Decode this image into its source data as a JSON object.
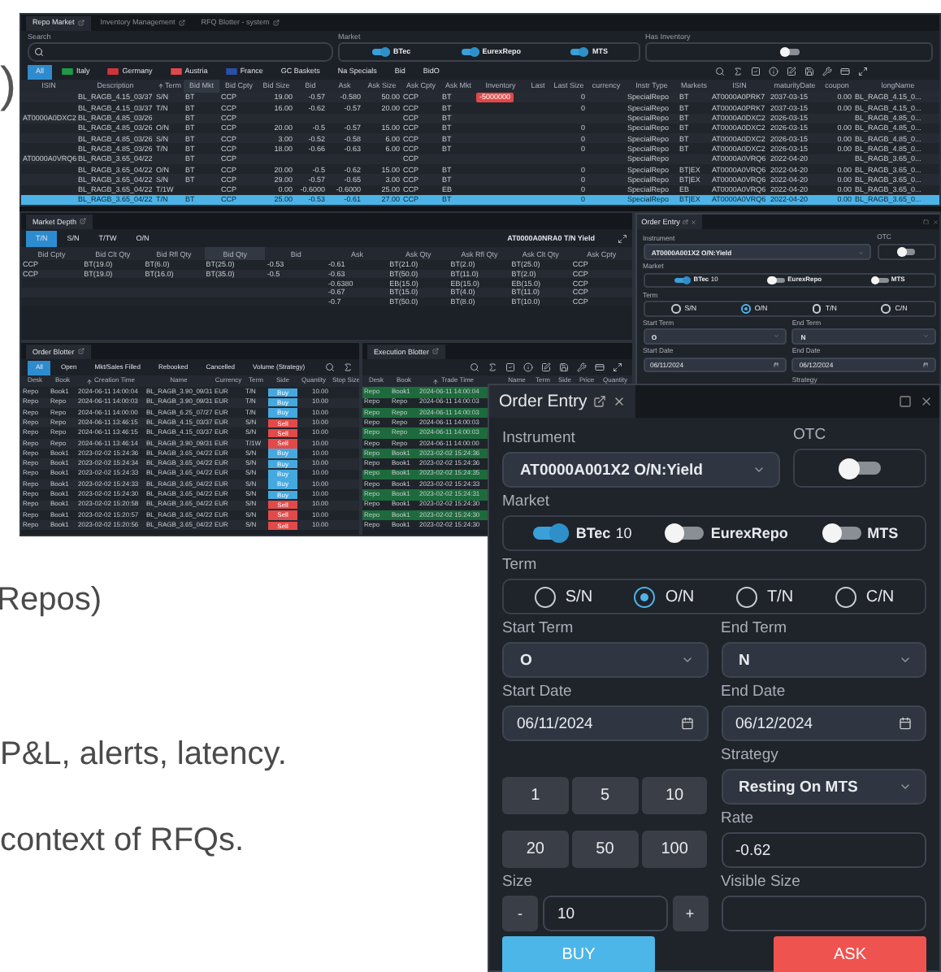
{
  "page_text": {
    "paren": ")",
    "line_1": "Repos)",
    "line_2": "P&L, alerts, latency.",
    "line_3": "context of RFQs."
  },
  "screenshot": {
    "tabs": [
      {
        "label": "Repo Market",
        "selected": true
      },
      {
        "label": "Inventory Management",
        "selected": false
      },
      {
        "label": "RFQ Blotter - system",
        "selected": false
      }
    ],
    "search_label": "Search",
    "market_label": "Market",
    "markets": [
      {
        "label": "BTec",
        "on": true
      },
      {
        "label": "EurexRepo",
        "on": true
      },
      {
        "label": "MTS",
        "on": true
      }
    ],
    "inventory_label": "Has Inventory",
    "inventory_on": false,
    "filters": [
      {
        "label": "All",
        "selected": true
      },
      {
        "label": "Italy",
        "selected": false,
        "color": "#1f9a48"
      },
      {
        "label": "Germany",
        "selected": false,
        "color": "#d0343b"
      },
      {
        "label": "Austria",
        "selected": false,
        "color": "#e0474c"
      },
      {
        "label": "France",
        "selected": false,
        "color": "#2a4fa8"
      },
      {
        "label": "GC Baskets",
        "selected": false
      },
      {
        "label": "Na Specials",
        "selected": false
      },
      {
        "label": "Bid",
        "selected": false
      },
      {
        "label": "BidO",
        "selected": false
      }
    ],
    "columns": [
      {
        "label": "ISIN",
        "sorted": false,
        "highlighted": false
      },
      {
        "label": "Description",
        "sorted": false,
        "highlighted": false
      },
      {
        "label": "Term",
        "sorted": true,
        "highlighted": false
      },
      {
        "label": "Bid Mkt",
        "sorted": false,
        "highlighted": true
      },
      {
        "label": "Bid Cpty",
        "sorted": false,
        "highlighted": false
      },
      {
        "label": "Bid Size",
        "sorted": false,
        "highlighted": false
      },
      {
        "label": "Bid",
        "sorted": false,
        "highlighted": false
      },
      {
        "label": "Ask",
        "sorted": false,
        "highlighted": false
      },
      {
        "label": "Ask Size",
        "sorted": false,
        "highlighted": false
      },
      {
        "label": "Ask Cpty",
        "sorted": false,
        "highlighted": false
      },
      {
        "label": "Ask Mkt",
        "sorted": false,
        "highlighted": false
      },
      {
        "label": "Inventory",
        "sorted": false,
        "highlighted": false
      },
      {
        "label": "Last",
        "sorted": false,
        "highlighted": false
      },
      {
        "label": "Last Size",
        "sorted": false,
        "highlighted": false
      },
      {
        "label": "currency",
        "sorted": false,
        "highlighted": false
      },
      {
        "label": "Instr Type",
        "sorted": false,
        "highlighted": false
      },
      {
        "label": "Markets",
        "sorted": false,
        "highlighted": false
      },
      {
        "label": "ISIN",
        "sorted": false,
        "highlighted": false
      },
      {
        "label": "maturityDate",
        "sorted": false,
        "highlighted": false
      },
      {
        "label": "coupon",
        "sorted": false,
        "highlighted": false
      },
      {
        "label": "longName",
        "sorted": false,
        "highlighted": false
      }
    ],
    "rows": [
      {
        "selected": false,
        "cells": [
          null,
          "BL_RAGB_4.15_03/37",
          "S/N",
          "BT",
          "CCP",
          "19.00",
          "-0.57",
          "-0.580",
          "50.00",
          "CCP",
          "BT",
          "-5000000",
          null,
          "0",
          null,
          "SpecialRepo",
          "BT",
          "AT0000A0PRK7",
          "2037-03-15",
          "0.00",
          "BL_RAGB_4.15_0..."
        ]
      },
      {
        "selected": false,
        "cells": [
          null,
          "BL_RAGB_4.15_03/37",
          "T/N",
          "BT",
          "CCP",
          "16.00",
          "-0.62",
          "-0.57",
          "20.00",
          "CCP",
          "BT",
          null,
          null,
          "0",
          null,
          "SpecialRepo",
          "BT",
          "AT0000A0PRK7",
          "2037-03-15",
          "0.00",
          "BL_RAGB_4.15_0..."
        ]
      },
      {
        "selected": false,
        "cells": [
          "AT0000A0DXC2",
          "BL_RAGB_4.85_03/26",
          null,
          "BT",
          "CCP",
          null,
          null,
          null,
          null,
          "CCP",
          "BT",
          null,
          null,
          null,
          null,
          "SpecialRepo",
          "BT",
          "AT0000A0DXC2",
          "2026-03-15",
          null,
          "BL_RAGB_4.85_0..."
        ]
      },
      {
        "selected": false,
        "cells": [
          null,
          "BL_RAGB_4.85_03/26",
          "O/N",
          "BT",
          "CCP",
          "20.00",
          "-0.5",
          "-0.57",
          "15.00",
          "CCP",
          "BT",
          null,
          null,
          "0",
          null,
          "SpecialRepo",
          "BT",
          "AT0000A0DXC2",
          "2026-03-15",
          "0.00",
          "BL_RAGB_4.85_0..."
        ]
      },
      {
        "selected": false,
        "cells": [
          null,
          "BL_RAGB_4.85_03/26",
          "S/N",
          "BT",
          "CCP",
          "3.00",
          "-0.52",
          "-0.58",
          "6.00",
          "CCP",
          "BT",
          null,
          null,
          "0",
          null,
          "SpecialRepo",
          "BT",
          "AT0000A0DXC2",
          "2026-03-15",
          "0.00",
          "BL_RAGB_4.85_0..."
        ]
      },
      {
        "selected": false,
        "cells": [
          null,
          "BL_RAGB_4.85_03/26",
          "T/N",
          "BT",
          "CCP",
          "18.00",
          "-0.66",
          "-0.63",
          "6.00",
          "CCP",
          "BT",
          null,
          null,
          "0",
          null,
          "SpecialRepo",
          "BT",
          "AT0000A0DXC2",
          "2026-03-15",
          "0.00",
          "BL_RAGB_4.85_0..."
        ]
      },
      {
        "selected": false,
        "cells": [
          "AT0000A0VRQ6",
          "BL_RAGB_3.65_04/22",
          null,
          "BT",
          "CCP",
          null,
          null,
          null,
          null,
          "CCP",
          null,
          null,
          null,
          null,
          null,
          "SpecialRepo",
          null,
          "AT0000A0VRQ6",
          "2022-04-20",
          null,
          "BL_RAGB_3.65_0..."
        ]
      },
      {
        "selected": false,
        "cells": [
          null,
          "BL_RAGB_3.65_04/22",
          "O/N",
          "BT",
          "CCP",
          "20.00",
          "-0.5",
          "-0.62",
          "15.00",
          "CCP",
          "BT",
          null,
          null,
          "0",
          null,
          "SpecialRepo",
          "BT|EX",
          "AT0000A0VRQ6",
          "2022-04-20",
          "0.00",
          "BL_RAGB_3.65_0..."
        ]
      },
      {
        "selected": false,
        "cells": [
          null,
          "BL_RAGB_3.65_04/22",
          "S/N",
          "BT",
          "CCP",
          "29.00",
          "-0.57",
          "-0.65",
          "3.00",
          "CCP",
          "BT",
          null,
          null,
          "0",
          null,
          "SpecialRepo",
          "BT|EX",
          "AT0000A0VRQ6",
          "2022-04-20",
          "0.00",
          "BL_RAGB_3.65_0..."
        ]
      },
      {
        "selected": false,
        "cells": [
          null,
          "BL_RAGB_3.65_04/22",
          "T/1W",
          null,
          "CCP",
          "0.00",
          "-0.6000",
          "-0.6000",
          "25.00",
          "CCP",
          "EB",
          null,
          null,
          "0",
          null,
          "SpecialRepo",
          "EB",
          "AT0000A0VRQ6",
          "2022-04-20",
          "0.00",
          "BL_RAGB_3.65_0..."
        ]
      },
      {
        "selected": true,
        "cells": [
          null,
          "BL_RAGB_3.65_04/22",
          "T/N",
          "BT",
          "CCP",
          "25.00",
          "-0.53",
          "-0.61",
          "27.00",
          "CCP",
          "BT",
          null,
          null,
          "0",
          null,
          "SpecialRepo",
          "BT|EX",
          "AT0000A0VRQ6",
          "2022-04-20",
          "0.00",
          "BL_RAGB_3.65_0..."
        ]
      }
    ],
    "depth": {
      "title": "Market Depth",
      "instrument": "AT0000A0NRA0 T/N Yield",
      "terms": [
        {
          "label": "T/N",
          "selected": true
        },
        {
          "label": "S/N",
          "selected": false
        },
        {
          "label": "T/TW",
          "selected": false
        },
        {
          "label": "O/N",
          "selected": false
        }
      ],
      "columns": [
        {
          "label": "Bid Cpty",
          "sorted": false,
          "highlighted": false
        },
        {
          "label": "Bid Clt Qty",
          "sorted": false,
          "highlighted": false
        },
        {
          "label": "Bid Rfl Qty",
          "sorted": false,
          "highlighted": false
        },
        {
          "label": "Bid Qty",
          "sorted": false,
          "highlighted": true
        },
        {
          "label": "Bid",
          "sorted": false,
          "highlighted": false
        },
        {
          "label": "Ask",
          "sorted": false,
          "highlighted": false
        },
        {
          "label": "Ask Qty",
          "sorted": false,
          "highlighted": false
        },
        {
          "label": "Ask Rfl Qty",
          "sorted": false,
          "highlighted": false
        },
        {
          "label": "Ask Clt Qty",
          "sorted": false,
          "highlighted": false
        },
        {
          "label": "Ask Cpty",
          "sorted": false,
          "highlighted": false
        }
      ],
      "rows": [
        [
          "CCP",
          "BT(19.0)",
          "BT(6.0)",
          "BT(25.0)",
          "-0.53",
          "-0.61",
          "BT(21.0)",
          "BT(2.0)",
          "BT(25.0)",
          "CCP"
        ],
        [
          "CCP",
          "BT(19.0)",
          "BT(16.0)",
          "BT(35.0)",
          "-0.5",
          "-0.63",
          "BT(50.0)",
          "BT(11.0)",
          "BT(2.0)",
          "CCP"
        ],
        [
          null,
          null,
          null,
          null,
          null,
          "-0.6380",
          "EB(15.0)",
          "EB(15.0)",
          "EB(15.0)",
          "CCP"
        ],
        [
          null,
          null,
          null,
          null,
          null,
          "-0.67",
          "BT(15.0)",
          "BT(4.0)",
          "BT(11.0)",
          "CCP"
        ],
        [
          null,
          null,
          null,
          null,
          null,
          "-0.7",
          "BT(50.0)",
          "BT(8.0)",
          "BT(10.0)",
          "CCP"
        ]
      ]
    },
    "order_blotter": {
      "title": "Order Blotter",
      "tabs": [
        {
          "label": "All",
          "selected": true
        },
        {
          "label": "Open",
          "selected": false
        },
        {
          "label": "Mkt/Sales Filled",
          "selected": false
        },
        {
          "label": "Rebooked",
          "selected": false
        },
        {
          "label": "Cancelled",
          "selected": false
        },
        {
          "label": "Volume (Strategy)",
          "selected": false
        }
      ],
      "columns": [
        {
          "label": "Desk",
          "sorted": false
        },
        {
          "label": "Book",
          "sorted": false
        },
        {
          "label": "Creation Time",
          "sorted": true
        },
        {
          "label": "Name",
          "sorted": false
        },
        {
          "label": "Currency",
          "sorted": false
        },
        {
          "label": "Term",
          "sorted": false
        },
        {
          "label": "Side",
          "sorted": false
        },
        {
          "label": "Quantity",
          "sorted": false
        },
        {
          "label": "Stop Size",
          "sorted": false
        }
      ],
      "rows": [
        {
          "desk": "Repo",
          "book": "Book1",
          "time": "2024-06-11 14:00:04",
          "name": "BL_RAGB_3.90_09/31",
          "currency": "EUR",
          "term": "T/N",
          "side": "Buy",
          "color": "#45a9df",
          "quantity": "10.00"
        },
        {
          "desk": "Repo",
          "book": "Repo",
          "time": "2024-06-11 14:00:03",
          "name": "BL_RAGB_3.90_09/31",
          "currency": "EUR",
          "term": "T/N",
          "side": "Buy",
          "color": "#45a9df",
          "quantity": "10.00"
        },
        {
          "desk": "Repo",
          "book": "Repo",
          "time": "2024-06-11 14:00:00",
          "name": "BL_RAGB_6.25_07/27",
          "currency": "EUR",
          "term": "T/N",
          "side": "Buy",
          "color": "#45a9df",
          "quantity": "10.00"
        },
        {
          "desk": "Repo",
          "book": "Repo",
          "time": "2024-06-11 13:46:15",
          "name": "BL_RAGB_4.15_03/37",
          "currency": "EUR",
          "term": "S/N",
          "side": "Sell",
          "color": "#e24a4a",
          "quantity": "10.00"
        },
        {
          "desk": "Repo",
          "book": "Repo",
          "time": "2024-06-11 13:46:15",
          "name": "BL_RAGB_4.15_03/37",
          "currency": "EUR",
          "term": "S/N",
          "side": "Sell",
          "color": "#e24a4a",
          "quantity": "10.00"
        },
        {
          "desk": "Repo",
          "book": "Repo",
          "time": "2024-06-11 13:46:14",
          "name": "BL_RAGB_3.90_09/31",
          "currency": "EUR",
          "term": "T/1W",
          "side": "Sell",
          "color": "#e24a4a",
          "quantity": "10.00"
        },
        {
          "desk": "Repo",
          "book": "Book1",
          "time": "2023-02-02 15:24:36",
          "name": "BL_RAGB_3.65_04/22",
          "currency": "EUR",
          "term": "S/N",
          "side": "Buy",
          "color": "#45a9df",
          "quantity": "10.00"
        },
        {
          "desk": "Repo",
          "book": "Book1",
          "time": "2023-02-02 15:24:34",
          "name": "BL_RAGB_3.65_04/22",
          "currency": "EUR",
          "term": "S/N",
          "side": "Buy",
          "color": "#45a9df",
          "quantity": "10.00"
        },
        {
          "desk": "Repo",
          "book": "Book1",
          "time": "2023-02-02 15:24:33",
          "name": "BL_RAGB_3.65_04/22",
          "currency": "EUR",
          "term": "S/N",
          "side": "Buy",
          "color": "#45a9df",
          "quantity": "10.00"
        },
        {
          "desk": "Repo",
          "book": "Book1",
          "time": "2023-02-02 15:24:33",
          "name": "BL_RAGB_3.65_04/22",
          "currency": "EUR",
          "term": "S/N",
          "side": "Buy",
          "color": "#45a9df",
          "quantity": "10.00"
        },
        {
          "desk": "Repo",
          "book": "Book1",
          "time": "2023-02-02 15:24:30",
          "name": "BL_RAGB_3.65_04/22",
          "currency": "EUR",
          "term": "S/N",
          "side": "Buy",
          "color": "#45a9df",
          "quantity": "10.00"
        },
        {
          "desk": "Repo",
          "book": "Book1",
          "time": "2023-02-02 15:20:58",
          "name": "BL_RAGB_3.65_04/22",
          "currency": "EUR",
          "term": "S/N",
          "side": "Sell",
          "color": "#e24a4a",
          "quantity": "10.00"
        },
        {
          "desk": "Repo",
          "book": "Book1",
          "time": "2023-02-02 15:20:57",
          "name": "BL_RAGB_3.65_04/22",
          "currency": "EUR",
          "term": "S/N",
          "side": "Sell",
          "color": "#e24a4a",
          "quantity": "10.00"
        },
        {
          "desk": "Repo",
          "book": "Book1",
          "time": "2023-02-02 15:20:56",
          "name": "BL_RAGB_3.65_04/22",
          "currency": "EUR",
          "term": "S/N",
          "side": "Sell",
          "color": "#e24a4a",
          "quantity": "10.00"
        }
      ]
    },
    "execution_blotter": {
      "title": "Execution Blotter",
      "columns": [
        {
          "label": "Desk",
          "sorted": false
        },
        {
          "label": "Book",
          "sorted": false
        },
        {
          "label": "Trade Time",
          "sorted": true
        },
        {
          "label": "Name",
          "sorted": false
        },
        {
          "label": "Term",
          "sorted": false
        },
        {
          "label": "Side",
          "sorted": false
        },
        {
          "label": "Price",
          "sorted": false
        },
        {
          "label": "Quantity",
          "sorted": false
        }
      ],
      "rows": [
        {
          "desk": "Repo",
          "book": "Book1",
          "time": "2024-06-11 14:00:04",
          "highlighted": true
        },
        {
          "desk": "Repo",
          "book": "Repo",
          "time": "2024-06-11 14:00:03",
          "highlighted": false
        },
        {
          "desk": "Repo",
          "book": "Repo",
          "time": "2024-06-11 14:00:03",
          "highlighted": true
        },
        {
          "desk": "Repo",
          "book": "Repo",
          "time": "2024-06-11 14:00:03",
          "highlighted": false
        },
        {
          "desk": "Repo",
          "book": "Repo",
          "time": "2024-06-11 14:00:03",
          "highlighted": true
        },
        {
          "desk": "Repo",
          "book": "Repo",
          "time": "2024-06-11 14:00:00",
          "highlighted": false
        },
        {
          "desk": "Repo",
          "book": "Book1",
          "time": "2023-02-02 15:24:36",
          "highlighted": true
        },
        {
          "desk": "Repo",
          "book": "Book1",
          "time": "2023-02-02 15:24:36",
          "highlighted": false
        },
        {
          "desk": "Repo",
          "book": "Book1",
          "time": "2023-02-02 15:24:35",
          "highlighted": true
        },
        {
          "desk": "Repo",
          "book": "Book1",
          "time": "2023-02-02 15:24:33",
          "highlighted": false
        },
        {
          "desk": "Repo",
          "book": "Book1",
          "time": "2023-02-02 15:24:31",
          "highlighted": true
        },
        {
          "desk": "Repo",
          "book": "Book1",
          "time": "2023-02-02 15:24:30",
          "highlighted": false
        },
        {
          "desk": "Repo",
          "book": "Book1",
          "time": "2023-02-02 15:24:30",
          "highlighted": true
        },
        {
          "desk": "Repo",
          "book": "Book1",
          "time": "2023-02-02 15:24:30",
          "highlighted": false
        }
      ]
    },
    "order_entry": {
      "title": "Order Entry",
      "instrument_label": "Instrument",
      "instrument": "AT0000A001X2 O/N:Yield",
      "otc_label": "OTC",
      "otc_on": false,
      "market_label": "Market",
      "markets": [
        {
          "label": "BTec",
          "on": true,
          "count": "10"
        },
        {
          "label": "EurexRepo",
          "on": false
        },
        {
          "label": "MTS",
          "on": false
        }
      ],
      "term_label": "Term",
      "terms": [
        {
          "label": "S/N",
          "selected": false
        },
        {
          "label": "O/N",
          "selected": true
        },
        {
          "label": "T/N",
          "selected": false
        },
        {
          "label": "C/N",
          "selected": false
        }
      ],
      "start_term_label": "Start Term",
      "start_term": "O",
      "end_term_label": "End Term",
      "end_term": "N",
      "start_date_label": "Start Date",
      "start_date": "06/11/2024",
      "end_date_label": "End Date",
      "end_date": "06/12/2024",
      "strategy_label": "Strategy"
    }
  },
  "order_entry": {
    "title": "Order Entry",
    "instrument_label": "Instrument",
    "instrument": "AT0000A001X2 O/N:Yield",
    "otc_label": "OTC",
    "otc_on": false,
    "market_label": "Market",
    "markets": [
      {
        "label": "BTec",
        "on": true,
        "count": "10"
      },
      {
        "label": "EurexRepo",
        "on": false
      },
      {
        "label": "MTS",
        "on": false
      }
    ],
    "term_label": "Term",
    "terms": [
      {
        "label": "S/N",
        "selected": false
      },
      {
        "label": "O/N",
        "selected": true
      },
      {
        "label": "T/N",
        "selected": false
      },
      {
        "label": "C/N",
        "selected": false
      }
    ],
    "start_term_label": "Start Term",
    "start_term": "O",
    "end_term_label": "End Term",
    "end_term": "N",
    "start_date_label": "Start Date",
    "start_date": "06/11/2024",
    "end_date_label": "End Date",
    "end_date": "06/12/2024",
    "strategy_label": "Strategy",
    "strategy": "Resting On MTS",
    "quick_sizes": [
      "1",
      "5",
      "10",
      "20",
      "50",
      "100"
    ],
    "rate_label": "Rate",
    "rate": "-0.62",
    "size_label": "Size",
    "minus": "-",
    "size": "10",
    "plus": "+",
    "visible_size_label": "Visible Size",
    "buy": "BUY",
    "ask": "ASK"
  }
}
